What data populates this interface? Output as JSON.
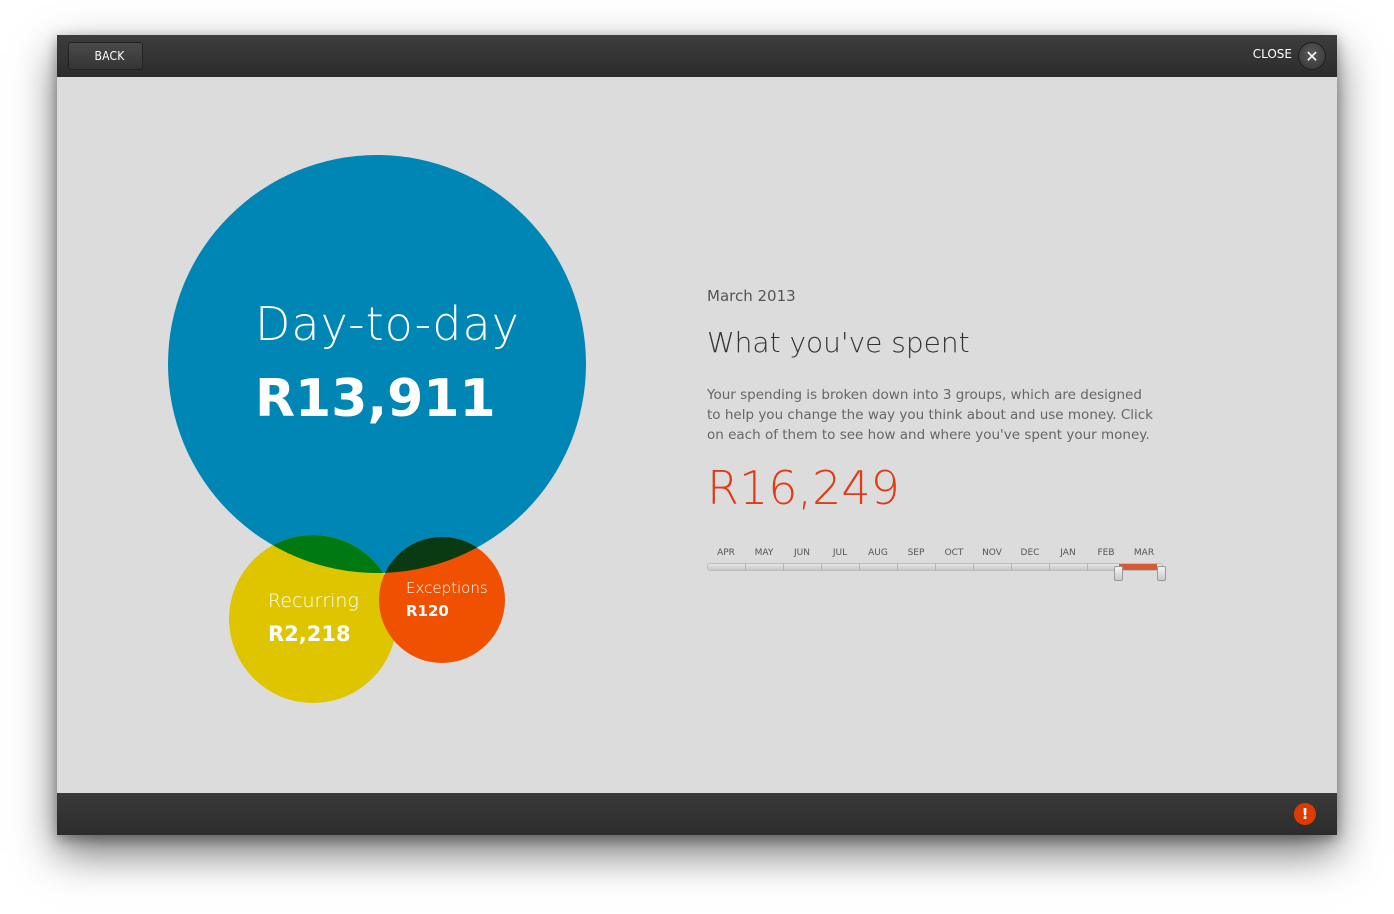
{
  "topbar": {
    "back_label": "BACK",
    "close_label": "CLOSE",
    "close_glyph": "✕"
  },
  "bottombar": {
    "alert_glyph": "!",
    "alert_icon": "alert-icon"
  },
  "spending": {
    "period": "March 2013",
    "heading": "What you've spent",
    "description": "Your spending is broken down into 3 groups, which are designed to help you change the way you think about and use money. Click on each of them to see how and where you've spent your money.",
    "total": "R16,249",
    "groups": [
      {
        "label": "Day-to-day",
        "value": "R13,911",
        "amount": 13911,
        "color": "#0086b5"
      },
      {
        "label": "Recurring",
        "value": "R2,218",
        "amount": 2218,
        "color": "#dec500"
      },
      {
        "label": "Exceptions",
        "value": "R120",
        "amount": 120,
        "color": "#f05100"
      }
    ]
  },
  "timeline": {
    "months": [
      "APR",
      "MAY",
      "JUN",
      "JUL",
      "AUG",
      "SEP",
      "OCT",
      "NOV",
      "DEC",
      "JAN",
      "FEB",
      "MAR"
    ],
    "selected": "MAR",
    "selection_color": "#d85a35"
  },
  "colors": {
    "background": "#dcdcdc",
    "bar": "#333333",
    "accent": "#e03a16",
    "overlap_blue_yellow": "#007a10",
    "overlap_blue_orange": "#0a3a12"
  }
}
